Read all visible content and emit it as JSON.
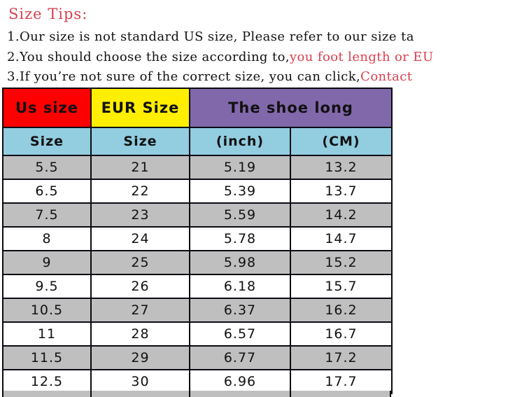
{
  "tips": {
    "title": "Size Tips:",
    "lines": [
      {
        "num": "1.",
        "black": "Our size is not standard US size, Please refer to our size ta",
        "red": ""
      },
      {
        "num": "2.",
        "black": "You should choose the size according to,",
        "red": "you foot length or EU"
      },
      {
        "num": "3.",
        "black": "If you’re not sure of the correct size, you can click,",
        "red": "Contact"
      }
    ]
  },
  "table": {
    "header_main": {
      "us": "Us size",
      "eur": "EUR Size",
      "shoe_long": "The shoe long"
    },
    "header_sub": {
      "us": "Size",
      "eur": "Size",
      "inch": "(inch)",
      "cm": "(CM)"
    },
    "columns": [
      "Us size",
      "EUR Size",
      "(inch)",
      "(CM)"
    ],
    "rows": [
      {
        "us": "5.5",
        "eur": "21",
        "inch": "5.19",
        "cm": "13.2"
      },
      {
        "us": "6.5",
        "eur": "22",
        "inch": "5.39",
        "cm": "13.7"
      },
      {
        "us": "7.5",
        "eur": "23",
        "inch": "5.59",
        "cm": "14.2"
      },
      {
        "us": "8",
        "eur": "24",
        "inch": "5.78",
        "cm": "14.7"
      },
      {
        "us": "9",
        "eur": "25",
        "inch": "5.98",
        "cm": "15.2"
      },
      {
        "us": "9.5",
        "eur": "26",
        "inch": "6.18",
        "cm": "15.7"
      },
      {
        "us": "10.5",
        "eur": "27",
        "inch": "6.37",
        "cm": "16.2"
      },
      {
        "us": "11",
        "eur": "28",
        "inch": "6.57",
        "cm": "16.7"
      },
      {
        "us": "11.5",
        "eur": "29",
        "inch": "6.77",
        "cm": "17.2"
      },
      {
        "us": "12.5",
        "eur": "30",
        "inch": "6.96",
        "cm": "17.7"
      }
    ]
  },
  "colors": {
    "us_header_bg": "#fe0000",
    "eur_header_bg": "#ffee00",
    "shoe_header_bg": "#8168ab",
    "sub_header_bg": "#92cde0",
    "row_alt_bg": "#bfbfbf",
    "row_bg": "#ffffff",
    "border": "#0b0b14",
    "tip_red": "#d8404f",
    "text": "#111111"
  }
}
